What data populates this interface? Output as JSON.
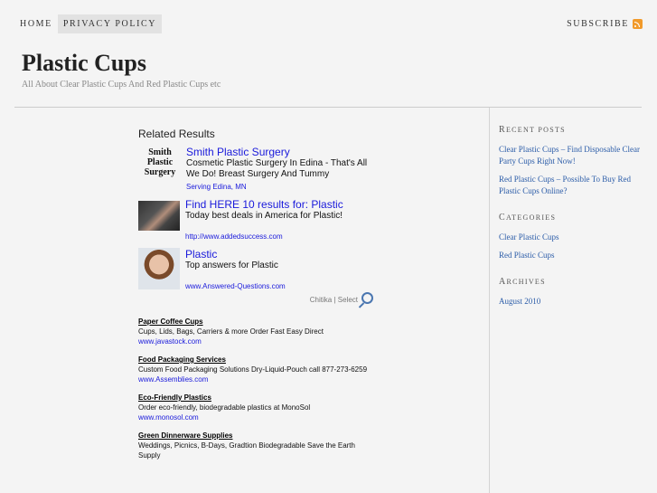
{
  "nav": {
    "items": [
      {
        "label": "Home"
      },
      {
        "label": "Privacy Policy"
      }
    ],
    "subscribe_label": "Subscribe"
  },
  "site": {
    "title": "Plastic Cups",
    "tagline": "All About Clear Plastic Cups And Red Plastic Cups etc"
  },
  "related": {
    "heading": "Related Results",
    "items": [
      {
        "logo_text": "Smith Plastic Surgery",
        "title": "Smith Plastic Surgery",
        "desc": "Cosmetic Plastic Surgery In Edina - That's All We Do! Breast Surgery And Tummy",
        "url": "Serving Edina, MN"
      },
      {
        "title": "Find HERE 10 results for: Plastic",
        "desc": "Today best deals in America for Plastic!",
        "url": "http://www.addedsuccess.com"
      },
      {
        "title": "Plastic",
        "desc": "Top answers for Plastic",
        "url": "www.Answered-Questions.com"
      }
    ],
    "chitika_label": "Chitika | Select"
  },
  "ads": [
    {
      "title": "Paper Coffee Cups",
      "desc": "Cups, Lids, Bags, Carriers & more Order Fast Easy Direct",
      "url": "www.javastock.com"
    },
    {
      "title": "Food Packaging Services",
      "desc": "Custom Food Packaging Solutions Dry-Liquid-Pouch call 877-273-6259",
      "url": "www.Assemblies.com"
    },
    {
      "title": "Eco-Friendly Plastics",
      "desc": "Order eco-friendly, biodegradable plastics at MonoSol",
      "url": "www.monosol.com"
    },
    {
      "title": "Green Dinnerware Supplies",
      "desc": "Weddings, Picnics, B-Days, Gradtion Biodegradable Save the Earth Supply",
      "url": ""
    }
  ],
  "sidebar": {
    "recent_posts": {
      "heading": "Recent Posts",
      "items": [
        {
          "label": "Clear Plastic Cups – Find Disposable Clear Party Cups Right Now!"
        },
        {
          "label": "Red Plastic Cups – Possible To Buy Red Plastic Cups Online?"
        }
      ]
    },
    "categories": {
      "heading": "Categories",
      "items": [
        {
          "label": "Clear Plastic Cups"
        },
        {
          "label": "Red Plastic Cups"
        }
      ]
    },
    "archives": {
      "heading": "Archives",
      "items": [
        {
          "label": "August 2010"
        }
      ]
    }
  },
  "colors": {
    "background": "#f4f4f4",
    "link": "#2b5ca8",
    "ad_link": "#1a1adb",
    "rss": "#f19a2b"
  }
}
